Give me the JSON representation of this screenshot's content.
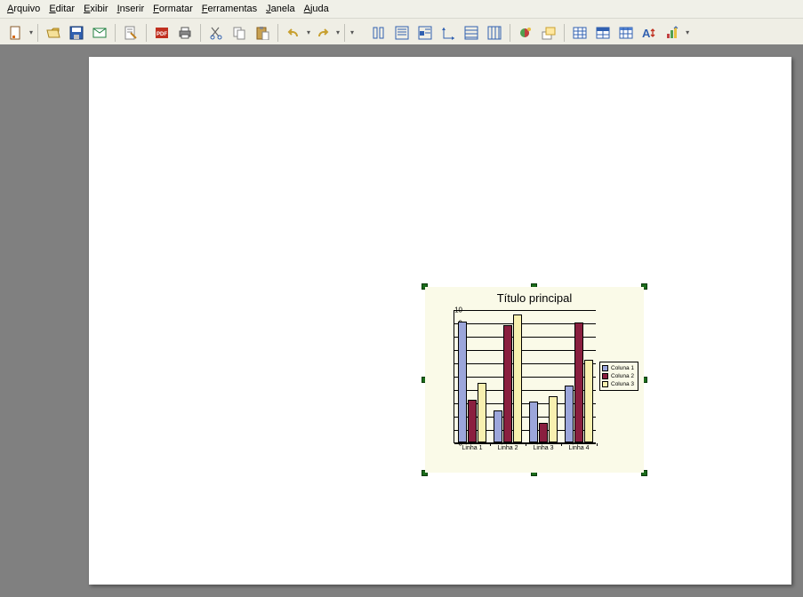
{
  "menu": {
    "items": [
      {
        "label": "Arquivo",
        "accel": "A"
      },
      {
        "label": "Editar",
        "accel": "E"
      },
      {
        "label": "Exibir",
        "accel": "E"
      },
      {
        "label": "Inserir",
        "accel": "I"
      },
      {
        "label": "Formatar",
        "accel": "F"
      },
      {
        "label": "Ferramentas",
        "accel": "F"
      },
      {
        "label": "Janela",
        "accel": "J"
      },
      {
        "label": "Ajuda",
        "accel": "A"
      }
    ]
  },
  "toolbar": {
    "icons": [
      "new-doc",
      "open",
      "save",
      "email",
      "edit-doc",
      "|",
      "pdf",
      "print",
      "|",
      "cut",
      "copy",
      "paste",
      "|",
      "undo",
      "redo",
      "|>",
      "layout-1",
      "layout-2",
      "layout-3",
      "layout-4",
      "layout-5",
      "layout-6",
      "|",
      "3d-chart",
      "arrange",
      "|",
      "table",
      "header-row",
      "grid-table",
      "font-size",
      "sort-chart",
      "|>"
    ]
  },
  "chart_data": {
    "type": "bar",
    "title": "Título principal",
    "categories": [
      "Linha 1",
      "Linha 2",
      "Linha 3",
      "Linha 4"
    ],
    "series": [
      {
        "name": "Coluna 1",
        "values": [
          9.1,
          2.4,
          3.1,
          4.3
        ],
        "color": "#9ca6db"
      },
      {
        "name": "Coluna 2",
        "values": [
          3.2,
          8.8,
          1.5,
          9.0
        ],
        "color": "#8a1f3f"
      },
      {
        "name": "Coluna 3",
        "values": [
          4.5,
          9.6,
          3.5,
          6.2
        ],
        "color": "#f8f0b0"
      }
    ],
    "ylim": [
      0,
      10
    ],
    "yticks": [
      0,
      1,
      2,
      3,
      4,
      5,
      6,
      7,
      8,
      9,
      10
    ]
  }
}
